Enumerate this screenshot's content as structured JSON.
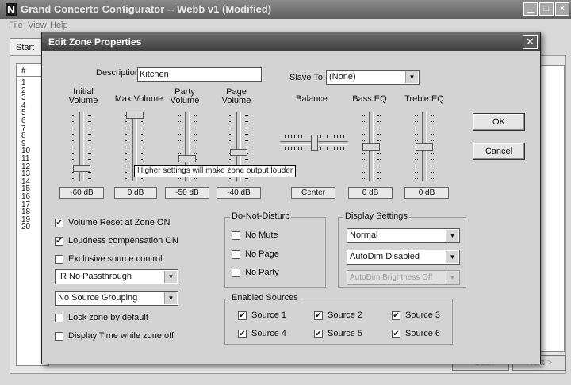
{
  "app": {
    "title": "Grand Concerto Configurator -- Webb v1 (Modified)",
    "logo": "N",
    "menu": [
      "File",
      "View",
      "Help"
    ],
    "tab_start": "Start",
    "list_header": "#",
    "list_rows": [
      "1",
      "2",
      "3",
      "4",
      "5",
      "6",
      "7",
      "8",
      "9",
      "10",
      "11",
      "12",
      "13",
      "14",
      "15",
      "16",
      "17",
      "18",
      "19",
      "20"
    ],
    "back_button": "< Back",
    "next_button": "Next >"
  },
  "dialog": {
    "title": "Edit Zone Properties",
    "description_label": "Description:",
    "description_value": "Kitchen",
    "slave_label": "Slave To:",
    "slave_value": "(None)",
    "ok": "OK",
    "cancel": "Cancel",
    "tooltip": "Higher settings will make zone output louder",
    "sliders": [
      {
        "label": "Initial Volume",
        "value": "-60 dB",
        "level": 0.15
      },
      {
        "label": "Max Volume",
        "value": "0 dB",
        "level": 1.0
      },
      {
        "label": "Party Volume",
        "value": "-50 dB",
        "level": 0.3
      },
      {
        "label": "Page Volume",
        "value": "-40 dB",
        "level": 0.4
      },
      {
        "label": "Balance",
        "value": "Center",
        "level": 0.5
      },
      {
        "label": "Bass EQ",
        "value": "0 dB",
        "level": 0.5
      },
      {
        "label": "Treble EQ",
        "value": "0 dB",
        "level": 0.5
      }
    ],
    "options": {
      "volume_reset": {
        "label": "Volume Reset at Zone ON",
        "checked": true
      },
      "loudness": {
        "label": "Loudness compensation ON",
        "checked": true
      },
      "exclusive": {
        "label": "Exclusive source control",
        "checked": false
      },
      "ir_select": "IR No Passthrough",
      "grouping_select": "No Source Grouping",
      "lock": {
        "label": "Lock zone by default",
        "checked": false
      },
      "display_time": {
        "label": "Display Time while zone off",
        "checked": false
      }
    },
    "dnd": {
      "title": "Do-Not-Disturb",
      "items": [
        {
          "label": "No Mute",
          "checked": false
        },
        {
          "label": "No Page",
          "checked": false
        },
        {
          "label": "No Party",
          "checked": false
        }
      ]
    },
    "display_settings": {
      "title": "Display Settings",
      "mode": "Normal",
      "autodim": "AutoDim Disabled",
      "brightness": "AutoDim Brightness Off"
    },
    "sources": {
      "title": "Enabled Sources",
      "items": [
        {
          "label": "Source 1",
          "checked": true
        },
        {
          "label": "Source 2",
          "checked": true
        },
        {
          "label": "Source 3",
          "checked": true
        },
        {
          "label": "Source 4",
          "checked": true
        },
        {
          "label": "Source 5",
          "checked": true
        },
        {
          "label": "Source 6",
          "checked": true
        }
      ]
    }
  }
}
